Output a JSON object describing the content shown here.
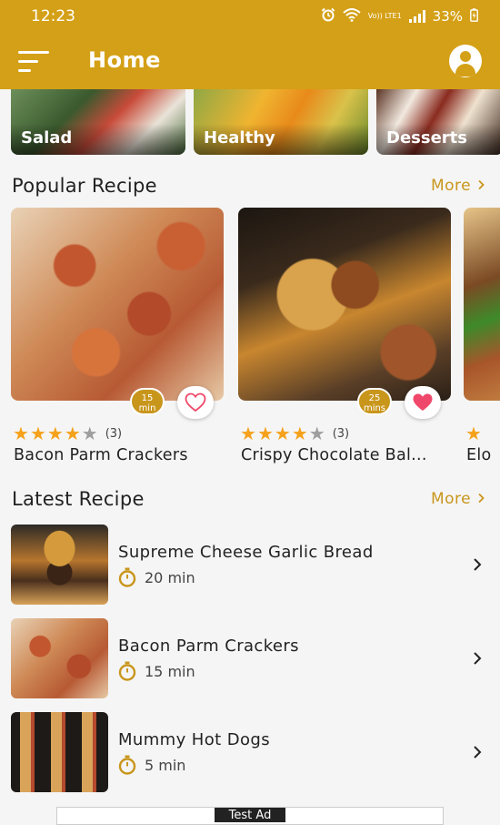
{
  "status_bar": {
    "time": "12:23",
    "network": "Vo)) LTE1",
    "battery": "33%"
  },
  "app_bar": {
    "title": "Home"
  },
  "categories": [
    {
      "label": "Salad"
    },
    {
      "label": "Healthy"
    },
    {
      "label": "Desserts"
    }
  ],
  "popular": {
    "title": "Popular Recipe",
    "more": "More",
    "recipes": [
      {
        "name": "Bacon Parm Crackers",
        "time_value": "15",
        "time_unit": "min",
        "rating": 4,
        "rating_count": "(3)",
        "favorite": false
      },
      {
        "name": "Crispy Chocolate Bal...",
        "time_value": "25",
        "time_unit": "mins",
        "rating": 4,
        "rating_count": "(3)",
        "favorite": true
      },
      {
        "name": "Elo",
        "rating": 1
      }
    ]
  },
  "latest": {
    "title": "Latest Recipe",
    "more": "More",
    "items": [
      {
        "title": "Supreme Cheese Garlic Bread",
        "time": "20 min"
      },
      {
        "title": "Bacon Parm Crackers",
        "time": "15 min"
      },
      {
        "title": "Mummy Hot Dogs",
        "time": "5 min"
      }
    ]
  },
  "ad": {
    "label": "Test Ad"
  },
  "colors": {
    "primary": "#d4a017",
    "accent": "#c9961c",
    "star": "#f5a11b",
    "heart": "#f0486a"
  }
}
